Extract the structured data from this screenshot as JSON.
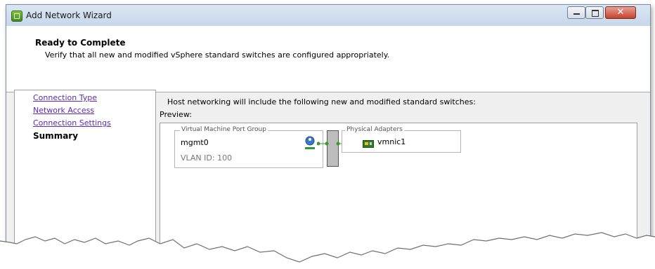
{
  "window": {
    "title": "Add Network Wizard",
    "close_glyph": "✕"
  },
  "header": {
    "title": "Ready to Complete",
    "subtitle": "Verify that all new and modified vSphere standard switches are configured appropriately."
  },
  "nav": {
    "items": [
      {
        "label": "Connection Type"
      },
      {
        "label": "Network Access"
      },
      {
        "label": "Connection Settings"
      },
      {
        "label": "Summary"
      }
    ]
  },
  "main": {
    "intro": "Host networking will include the following new and modified standard switches:",
    "preview_label": "Preview:",
    "port_group": {
      "title": "Virtual Machine Port Group",
      "name": "mgmt0",
      "vlan": "VLAN ID: 100"
    },
    "physical_adapters": {
      "title": "Physical Adapters",
      "items": [
        {
          "name": "vmnic1"
        }
      ]
    }
  },
  "icons": {
    "app": "vsphere-wizard-icon",
    "vm": "virtual-machine-icon",
    "nic": "network-adapter-icon"
  },
  "colors": {
    "link": "#5a28c8",
    "connector": "#3a9a2e"
  }
}
